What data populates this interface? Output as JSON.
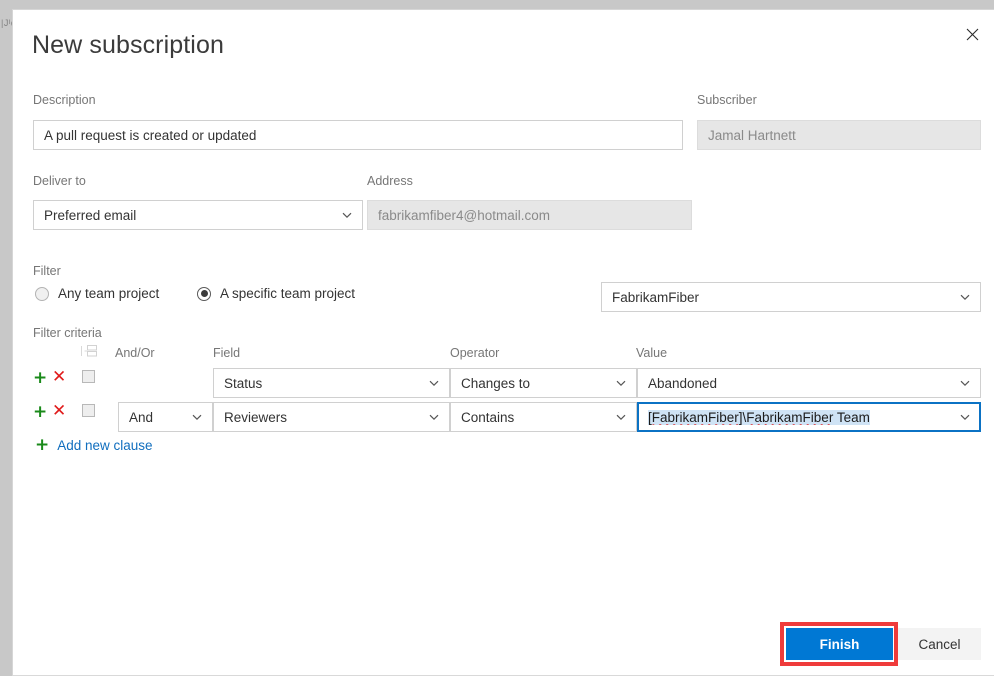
{
  "dialog": {
    "title": "New subscription",
    "close_icon": "close-icon"
  },
  "backdrop": {
    "edge_text": "| J ᴵ ɑ c ᵀ ʟ ᴇ ʀ ғ ᵉ ⌐ ¬ ⌐ ᵌ ᴇ ⌐ ⌐ ┐"
  },
  "description": {
    "label": "Description",
    "value": "A pull request is created or updated"
  },
  "subscriber": {
    "label": "Subscriber",
    "value": "Jamal Hartnett"
  },
  "deliver_to": {
    "label": "Deliver to",
    "value": "Preferred email"
  },
  "address": {
    "label": "Address",
    "value": "fabrikamfiber4@hotmail.com"
  },
  "filter": {
    "label": "Filter",
    "options": [
      {
        "label": "Any team project",
        "checked": false
      },
      {
        "label": "A specific team project",
        "checked": true
      }
    ],
    "project_value": "FabrikamFiber"
  },
  "criteria": {
    "label": "Filter criteria",
    "group_icon": "group-rows-icon",
    "headers": {
      "andor": "And/Or",
      "field": "Field",
      "operator": "Operator",
      "value": "Value"
    },
    "rows": [
      {
        "add_icon": "plus-icon",
        "delete_icon": "delete-icon",
        "checked": false,
        "andor": "",
        "field": "Status",
        "operator": "Changes to",
        "value": "Abandoned",
        "focused": false
      },
      {
        "add_icon": "plus-icon",
        "delete_icon": "delete-icon",
        "checked": false,
        "andor": "And",
        "field": "Reviewers",
        "operator": "Contains",
        "value_part1": "[FabrikamFiber]",
        "value_part2": "\\",
        "value_part3": "FabrikamFiber",
        "value_part4": " Team",
        "value": "[FabrikamFiber]\\FabrikamFiber Team",
        "focused": true
      }
    ],
    "add_clause": {
      "icon": "plus-icon",
      "label": "Add new clause"
    }
  },
  "footer": {
    "finish_label": "Finish",
    "cancel_label": "Cancel"
  },
  "colors": {
    "accent_blue": "#0078d4",
    "link_blue": "#106ebe",
    "focus_border": "#0b72c4",
    "selection_highlight": "#cfe3f5",
    "green": "#1a8a1a",
    "red": "#e01b1b",
    "annotation_red": "#ef3b3b",
    "label_gray": "#767676",
    "readonly_bg": "#e6e6e6"
  }
}
